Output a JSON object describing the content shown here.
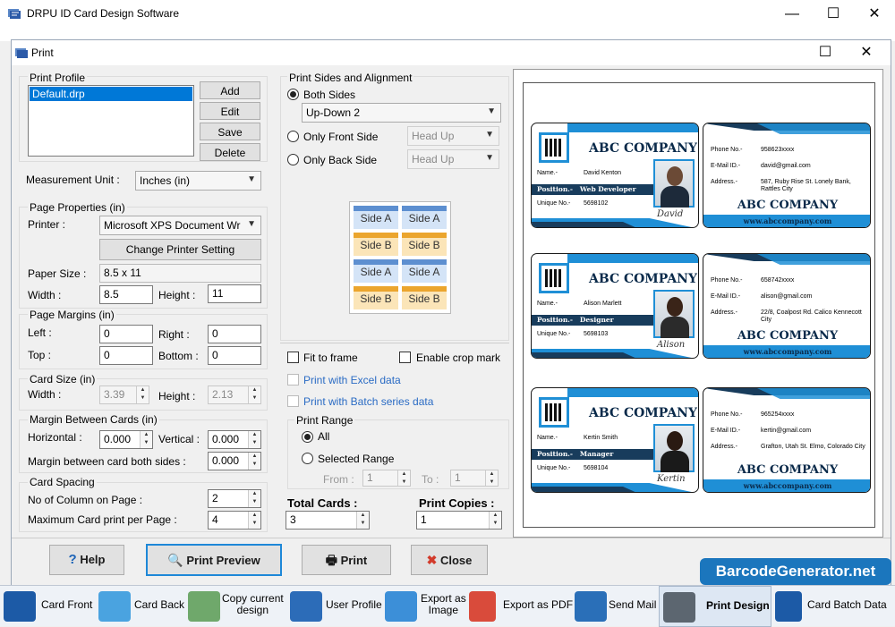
{
  "app": {
    "title": "DRPU ID Card Design Software",
    "minimize": "—",
    "maximize": "☐",
    "close": "✕"
  },
  "dialog": {
    "title": "Print",
    "maximize": "☐",
    "close": "✕"
  },
  "print_profile": {
    "legend": "Print Profile",
    "profiles": [
      "Default.drp"
    ],
    "add": "Add",
    "edit": "Edit",
    "save": "Save",
    "delete": "Delete"
  },
  "measurement": {
    "label": "Measurement Unit :",
    "value": "Inches (in)"
  },
  "page_properties": {
    "legend": "Page Properties (in)",
    "printer_label": "Printer :",
    "printer_value": "Microsoft XPS Document Wr",
    "change_printer": "Change Printer Setting",
    "paper_size_label": "Paper Size :",
    "paper_size": "8.5 x 11",
    "width_label": "Width :",
    "width": "8.5",
    "height_label": "Height :",
    "height": "11"
  },
  "page_margins": {
    "legend": "Page Margins (in)",
    "left_label": "Left :",
    "left": "0",
    "right_label": "Right :",
    "right": "0",
    "top_label": "Top :",
    "top": "0",
    "bottom_label": "Bottom :",
    "bottom": "0"
  },
  "card_size": {
    "legend": "Card Size (in)",
    "width_label": "Width :",
    "width": "3.39",
    "height_label": "Height :",
    "height": "2.13"
  },
  "margin_between": {
    "legend": "Margin Between Cards (in)",
    "horizontal_label": "Horizontal :",
    "horizontal": "0.000",
    "vertical_label": "Vertical :",
    "vertical": "0.000",
    "both_sides_label": "Margin between card both sides :",
    "both_sides": "0.000"
  },
  "card_spacing": {
    "legend": "Card Spacing",
    "columns_label": "No of Column on Page :",
    "columns": "2",
    "max_label": "Maximum Card print per Page :",
    "max": "4"
  },
  "sides": {
    "legend": "Print Sides and Alignment",
    "both": "Both Sides",
    "both_mode": "Up-Down 2",
    "front_only": "Only Front Side",
    "front_mode": "Head Up",
    "back_only": "Only Back Side",
    "back_mode": "Head Up",
    "side_a": "Side A",
    "side_b": "Side B"
  },
  "options": {
    "fit_to_frame": "Fit to frame",
    "crop_mark": "Enable crop mark",
    "excel": "Print with Excel data",
    "batch": "Print with Batch series data"
  },
  "print_range": {
    "legend": "Print Range",
    "all": "All",
    "selected": "Selected Range",
    "from_label": "From :",
    "from": "1",
    "to_label": "To :",
    "to": "1"
  },
  "totals": {
    "total_label": "Total Cards :",
    "total": "3",
    "copies_label": "Print Copies :",
    "copies": "1"
  },
  "cards": [
    {
      "company": "ABC COMPANY",
      "name_label": "Name.-",
      "name": "David Kenton",
      "position_label": "Position.-",
      "position": "Web Developer",
      "unique_label": "Unique No.-",
      "unique": "5698102",
      "signature": "David",
      "phone_label": "Phone No.-",
      "phone": "958623xxxx",
      "email_label": "E-Mail ID.-",
      "email": "david@gmail.com",
      "address_label": "Address.-",
      "address": "587, Ruby Rise St. Lonely Bank, Rattles City",
      "website": "www.abccompany.com"
    },
    {
      "company": "ABC COMPANY",
      "name_label": "Name.-",
      "name": "Alison Marlett",
      "position_label": "Position.-",
      "position": "Designer",
      "unique_label": "Unique No.-",
      "unique": "5698103",
      "signature": "Alison",
      "phone_label": "Phone No.-",
      "phone": "658742xxxx",
      "email_label": "E-Mail ID.-",
      "email": "alison@gmail.com",
      "address_label": "Address.-",
      "address": "22/8, Coalpost Rd. Calico Kennecott City",
      "website": "www.abccompany.com"
    },
    {
      "company": "ABC COMPANY",
      "name_label": "Name.-",
      "name": "Kertin Smith",
      "position_label": "Position.-",
      "position": "Manager",
      "unique_label": "Unique No.-",
      "unique": "5698104",
      "signature": "Kertin",
      "phone_label": "Phone No.-",
      "phone": "965254xxxx",
      "email_label": "E-Mail ID.-",
      "email": "kertin@gmail.com",
      "address_label": "Address.-",
      "address": "Grafton, Utah St. Elmo, Colorado City",
      "website": "www.abccompany.com"
    }
  ],
  "buttons": {
    "help": "Help",
    "print_preview": "Print Preview",
    "print": "Print",
    "close": "Close"
  },
  "watermark": "BarcodeGenerator.net",
  "taskbar": {
    "card_front": "Card Front",
    "card_back": "Card Back",
    "copy_design_1": "Copy current",
    "copy_design_2": "design",
    "user_profile": "User Profile",
    "export_image_1": "Export as",
    "export_image_2": "Image",
    "export_pdf": "Export as PDF",
    "send_mail": "Send Mail",
    "print_design": "Print Design",
    "card_batch": "Card Batch Data"
  },
  "colors": {
    "accent": "#1f8fd6",
    "navy": "#183c5c",
    "selection": "#0078d7",
    "watermark": "#1b76bd"
  }
}
